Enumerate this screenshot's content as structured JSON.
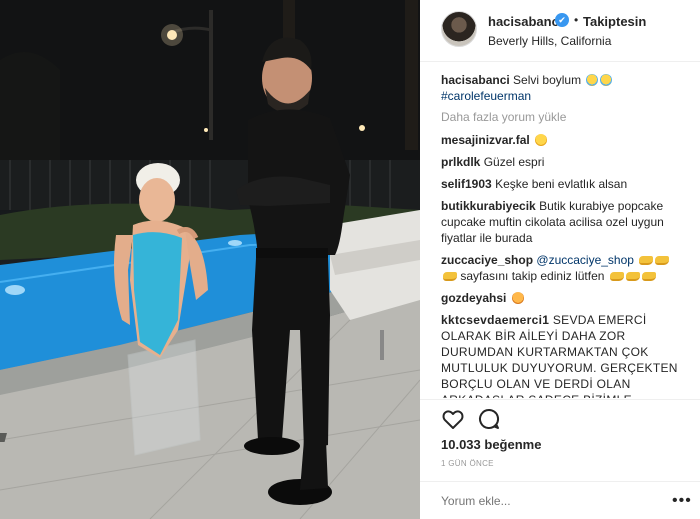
{
  "header": {
    "username": "hacisabanci",
    "verified_icon": "✔",
    "dot": "•",
    "follow_label": "Takiptesin",
    "location": "Beverly Hills, California"
  },
  "caption": {
    "username": "hacisabanci",
    "text": "Selvi boylum",
    "hashtag": "#carolefeuerman"
  },
  "load_more": "Daha fazla yorum yükle",
  "comments": [
    {
      "user": "mesajinizvar.fal",
      "text": ""
    },
    {
      "user": "prlkdlk",
      "text": "Güzel espri"
    },
    {
      "user": "selif1903",
      "text": "Keşke beni evlatlık alsan"
    },
    {
      "user": "butikkurabiyecik",
      "text": "Butik kurabiye popcake cupcake muftin cikolata acilisa ozel uygun fiyatlar ile burada"
    },
    {
      "user": "zuccaciye_shop",
      "mention": "@zuccaciye_shop",
      "text": "sayfasını takip ediniz lütfen"
    },
    {
      "user": "gozdeyahsi",
      "text": ""
    },
    {
      "user": "kktcsevdaemerci1",
      "text": "SEVDA EMERCİ OLARAK BİR AİLEYİ DAHA ZOR DURUMDAN KURTARMAKTAN ÇOK MUTLULUK DUYUYORUM. GERÇEKTEN BORÇLU OLAN VE DERDİ OLAN ARKADAŞLAR SADECE BİZİMLE İLETİŞİME GEÇMESİ YETERLİDİR"
    }
  ],
  "likes": "10.033 beğenme",
  "time": "1 GÜN ÖNCE",
  "add_comment_placeholder": "Yorum ekle...",
  "more_options": "•••",
  "icons": {
    "heart": "heart-icon",
    "comment": "comment-icon",
    "verified": "verified-badge-icon",
    "more": "more-options-icon"
  },
  "colors": {
    "link": "#003569",
    "verified": "#3897f0",
    "muted": "#999999",
    "text": "#262626"
  }
}
